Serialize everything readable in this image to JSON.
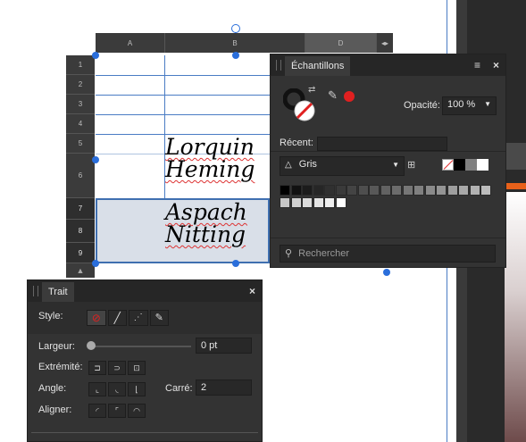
{
  "spreadsheet": {
    "columns": [
      "A",
      "B",
      "D"
    ],
    "rows": [
      "1",
      "2",
      "3",
      "4",
      "5",
      "6",
      "7",
      "8",
      "9"
    ],
    "cell_text": [
      "Lorquin",
      "Heming",
      "Aspach",
      "Nitting"
    ]
  },
  "swatches_panel": {
    "tab_title": "Échantillons",
    "opacity_label": "Opacité:",
    "opacity_value": "100 %",
    "recent_label": "Récent:",
    "palette_name": "Gris",
    "search_placeholder": "Rechercher",
    "colors": {
      "fill": "#e02020",
      "gray_levels": [
        "#000000",
        "#111111",
        "#1c1c1c",
        "#262626",
        "#303030",
        "#3a3a3a",
        "#444444",
        "#4e4e4e",
        "#585858",
        "#626262",
        "#6c6c6c",
        "#767676",
        "#808080",
        "#8a8a8a",
        "#949494",
        "#9e9e9e",
        "#a8a8a8",
        "#b2b2b2",
        "#bcbcbc",
        "#c6c6c6",
        "#d0d0d0",
        "#dadada",
        "#e4e4e4",
        "#eeeeee",
        "#ffffff"
      ]
    }
  },
  "stroke_panel": {
    "tab_title": "Trait",
    "style_label": "Style:",
    "width_label": "Largeur:",
    "width_value": "0 pt",
    "cap_label": "Extrémité:",
    "join_label": "Angle:",
    "miter_label": "Carré:",
    "miter_value": "2",
    "align_label": "Aligner:"
  }
}
